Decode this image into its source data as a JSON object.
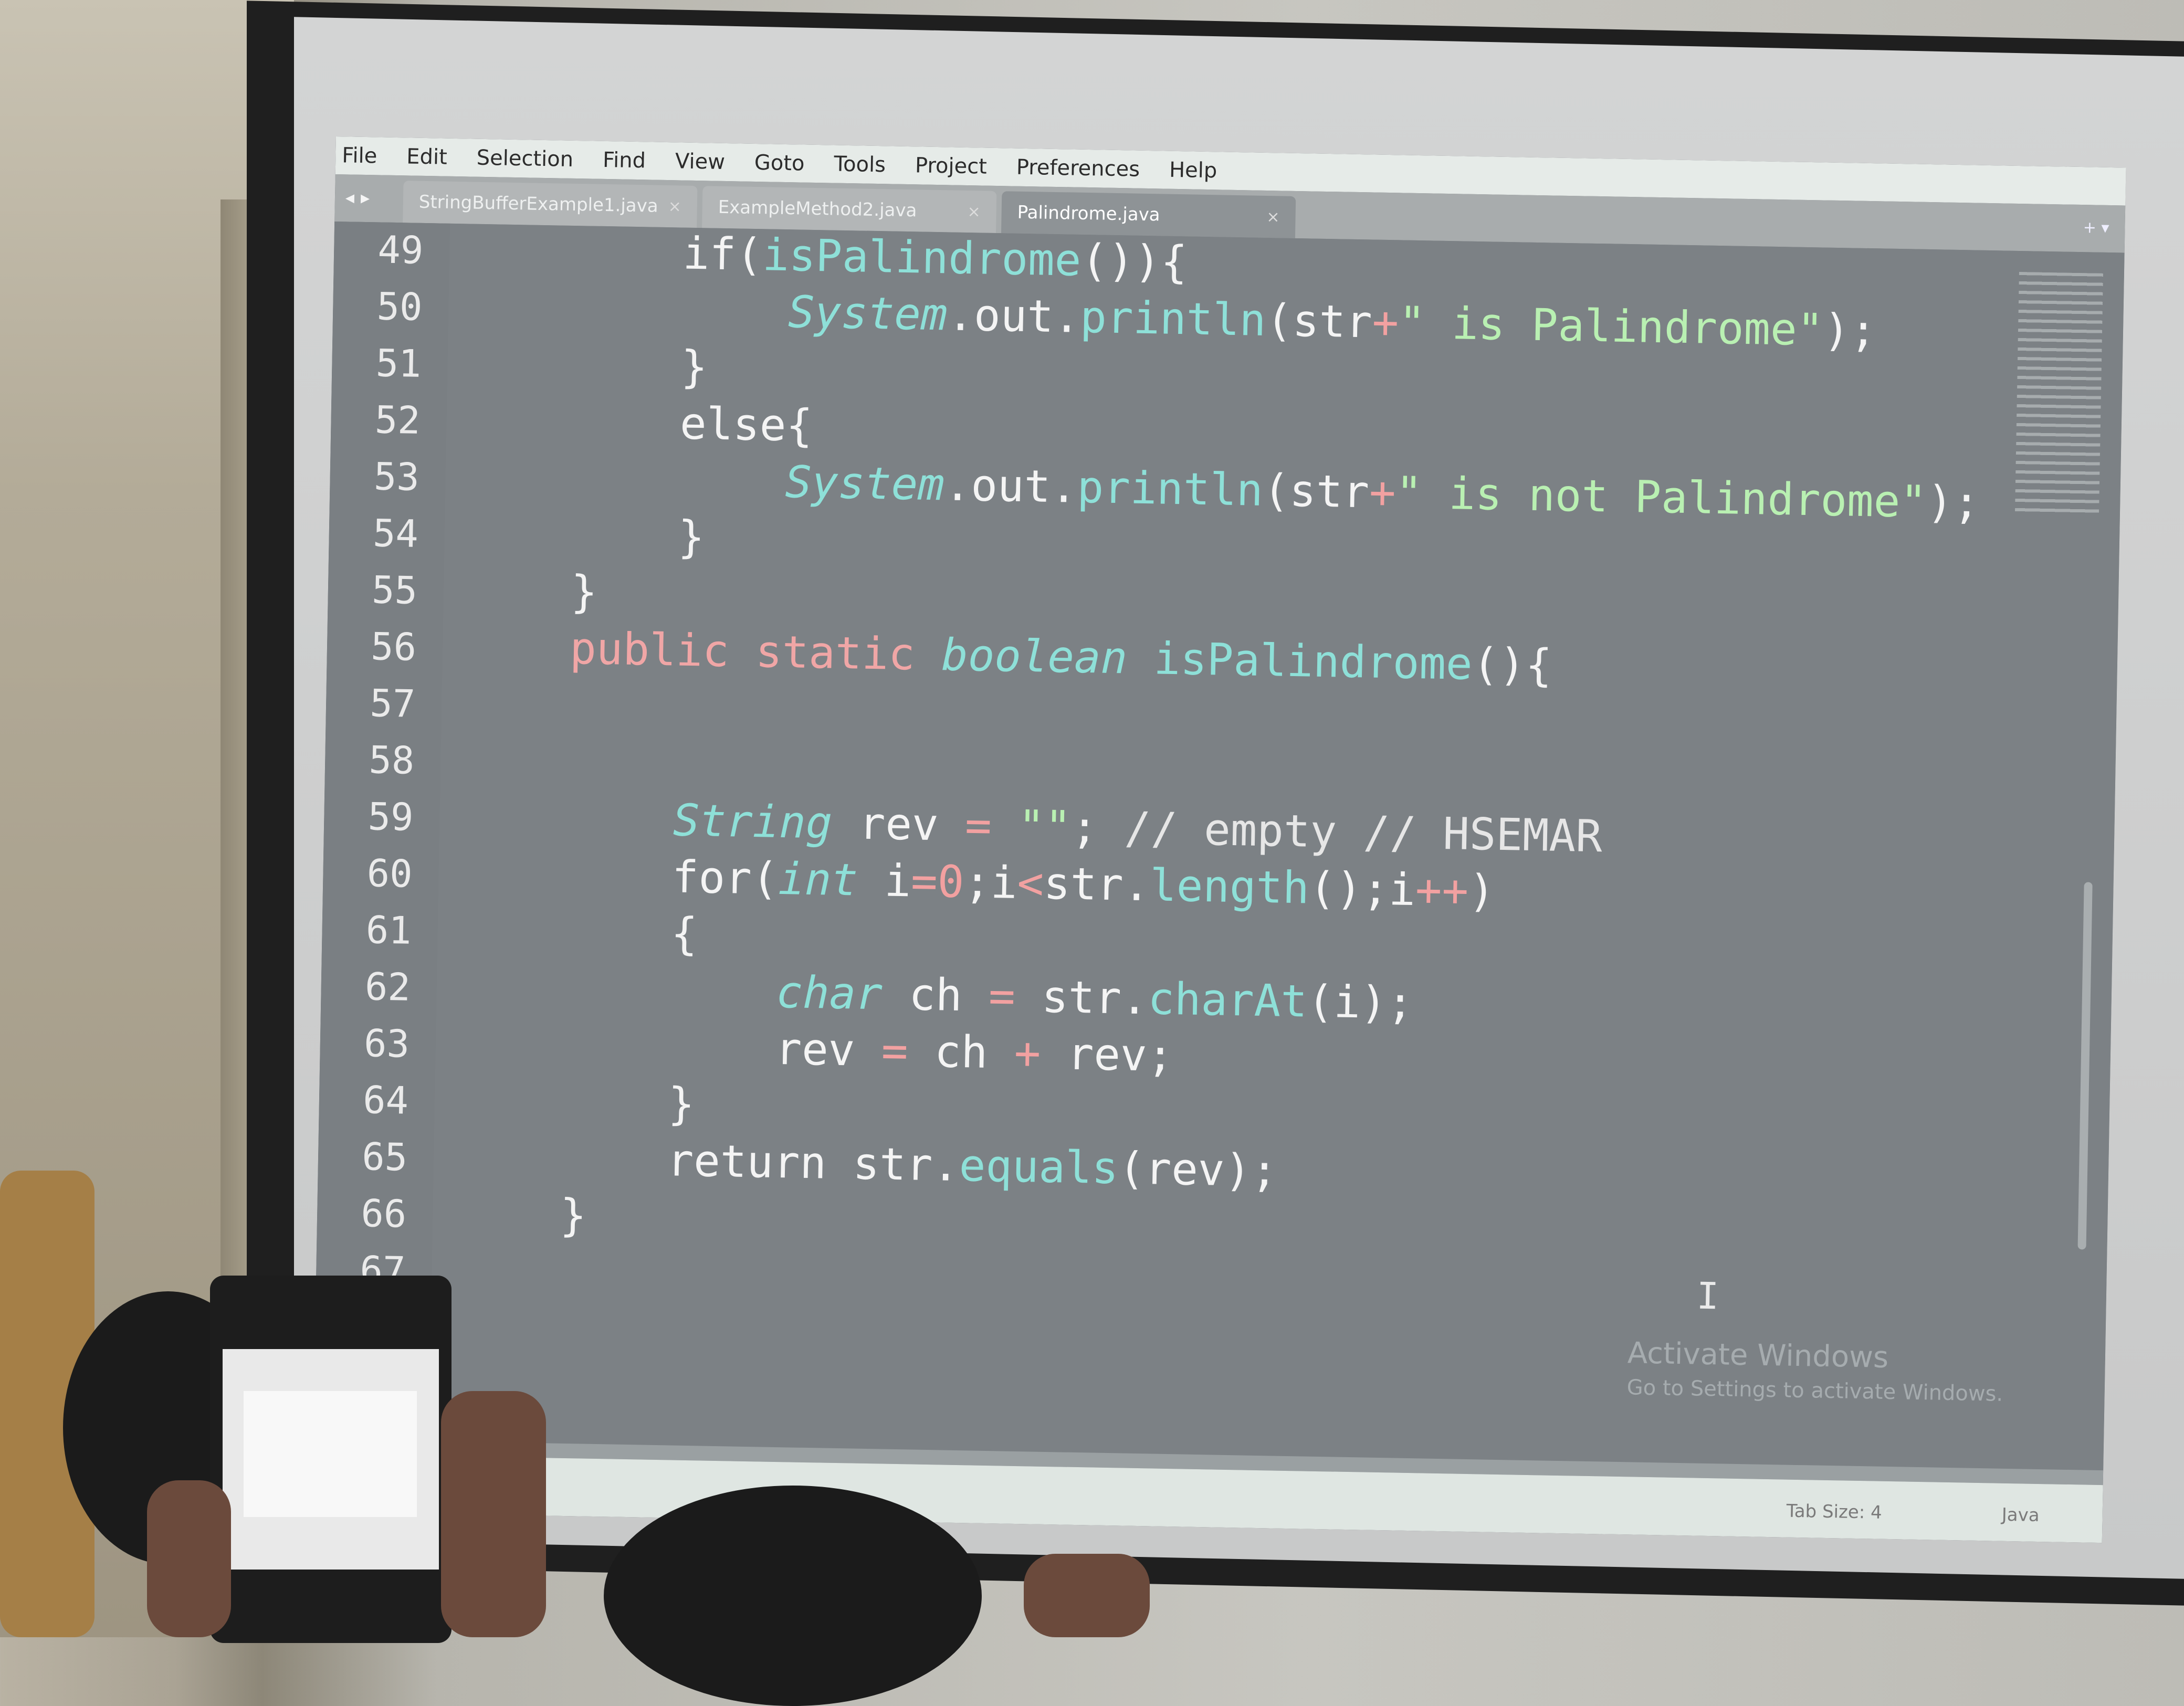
{
  "menu": {
    "items": [
      "File",
      "Edit",
      "Selection",
      "Find",
      "View",
      "Goto",
      "Tools",
      "Project",
      "Preferences",
      "Help"
    ]
  },
  "tabs": [
    {
      "label": "StringBufferExample1.java",
      "active": false
    },
    {
      "label": "ExampleMethod2.java",
      "active": false
    },
    {
      "label": "Palindrome.java",
      "active": true
    }
  ],
  "icons": {
    "nav": "nav-arrows-icon",
    "close": "close-icon"
  },
  "editor": {
    "line_numbers": [
      "49",
      "50",
      "51",
      "52",
      "53",
      "54",
      "55",
      "56",
      "57",
      "58",
      "59",
      "60",
      "61",
      "62",
      "63",
      "64",
      "65",
      "66",
      "67"
    ],
    "lines": [
      "        if(isPalindrome()){",
      "            System.out.println(str+\" is Palindrome\");",
      "        }",
      "        else{",
      "            System.out.println(str+\" is not Palindrome\");",
      "        }",
      "    }",
      "    public static boolean isPalindrome(){",
      "",
      "",
      "        String rev = \"\"; // empty // HSEMAR",
      "        for(int i=0;i<str.length();i++)",
      "        {",
      "            char ch = str.charAt(i);",
      "            rev = ch + rev;",
      "        }",
      "        return str.equals(rev);",
      "    }",
      ""
    ]
  },
  "watermark": {
    "title": "Activate Windows",
    "subtitle": "Go to Settings to activate Windows."
  },
  "status": {
    "tab_size": "Tab Size: 4",
    "language": "Java"
  },
  "colors": {
    "editor_bg": "#7c8185",
    "keyword": "#f0a6a6",
    "function": "#8ee0d8",
    "string": "#b9f0b2",
    "operator": "#f2a1a1"
  }
}
